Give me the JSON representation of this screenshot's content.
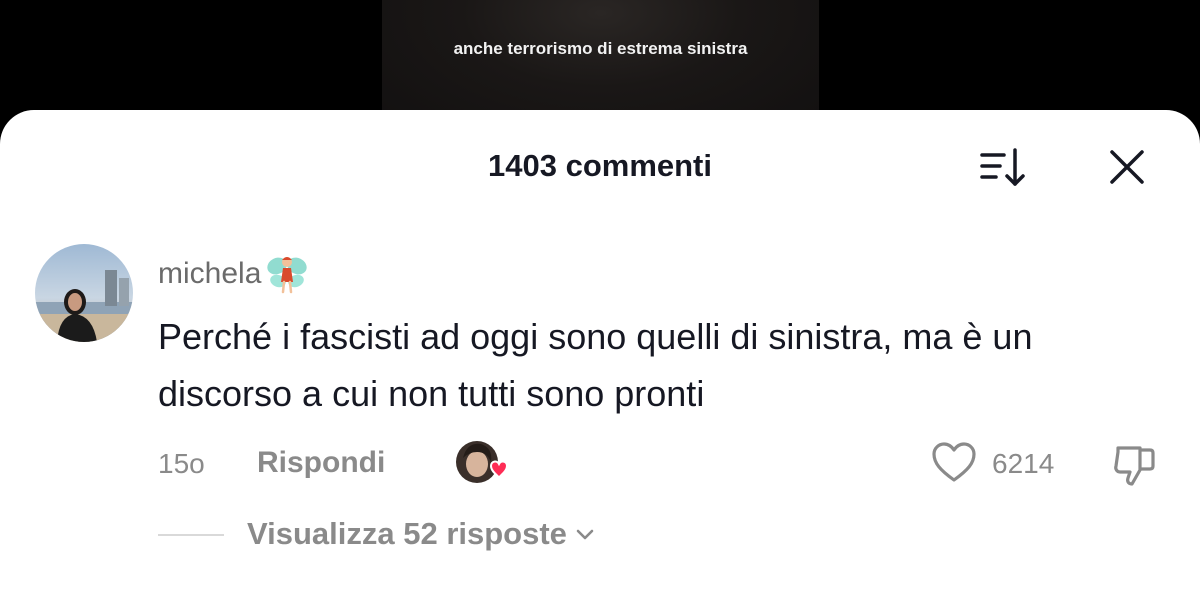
{
  "video": {
    "subtitle": "anche terrorismo di estrema sinistra"
  },
  "header": {
    "title": "1403 commenti",
    "sort_icon": "sort-icon",
    "close_icon": "close-icon"
  },
  "comment": {
    "username": "michela",
    "username_emoji": "fairy-emoji",
    "text": "Perché i fascisti ad oggi sono quelli di sinistra, ma è un discorso a cui non tutti sono pronti",
    "age": "15o",
    "reply_label": "Rispondi",
    "like_count": "6214",
    "view_replies_label": "Visualizza 52 risposte"
  },
  "colors": {
    "heart_badge": "#fe2c55",
    "muted": "#8a8a8a",
    "text": "#161823"
  }
}
